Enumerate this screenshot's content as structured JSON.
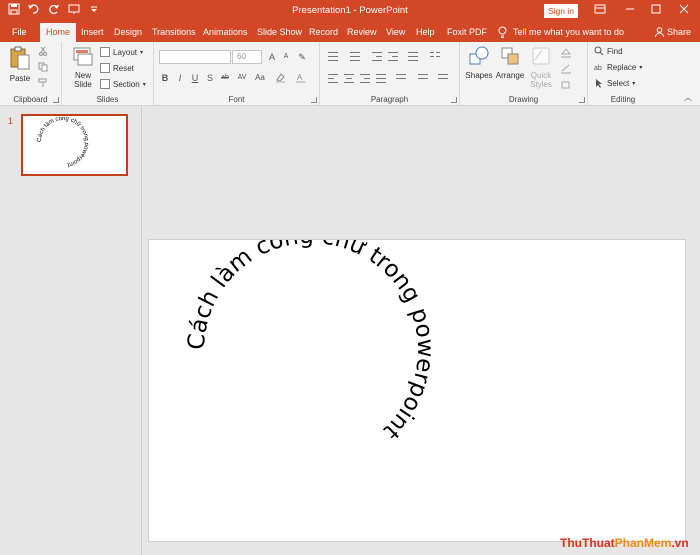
{
  "titlebar": {
    "title": "Presentation1  -  PowerPoint",
    "sign_in": "Sign in",
    "qat": [
      "save-icon",
      "undo-icon",
      "redo-icon",
      "present-icon",
      "customize-icon"
    ]
  },
  "tabs": [
    "File",
    "Home",
    "Insert",
    "Design",
    "Transitions",
    "Animations",
    "Slide Show",
    "Record",
    "Review",
    "View",
    "Help",
    "Foxit PDF"
  ],
  "active_tab": "Home",
  "tell_me": "Tell me what you want to do",
  "share": "Share",
  "ribbon": {
    "clipboard": {
      "label": "Clipboard",
      "paste": "Paste"
    },
    "slides": {
      "label": "Slides",
      "new_slide_line1": "New",
      "new_slide_line2": "Slide",
      "layout": "Layout",
      "reset": "Reset",
      "section": "Section"
    },
    "font": {
      "label": "Font",
      "size": "60",
      "buttons": [
        "B",
        "I",
        "U",
        "S",
        "ab",
        "AV",
        "Aa"
      ]
    },
    "paragraph": {
      "label": "Paragraph"
    },
    "drawing": {
      "label": "Drawing",
      "shapes": "Shapes",
      "arrange": "Arrange",
      "quick_styles_line1": "Quick",
      "quick_styles_line2": "Styles"
    },
    "editing": {
      "label": "Editing",
      "find": "Find",
      "replace": "Replace",
      "select": "Select"
    }
  },
  "slides_panel": {
    "slide_number": "1"
  },
  "slide": {
    "curved_text": "Cách làm cong chữ trong powerpoint"
  },
  "watermark": {
    "part1": "ThuThuat",
    "part2": "PhanMem",
    "part3": ".vn"
  },
  "colors": {
    "accent": "#d24726",
    "ribbon_bg": "#f3f3f3",
    "canvas_bg": "#e6e6e6"
  }
}
